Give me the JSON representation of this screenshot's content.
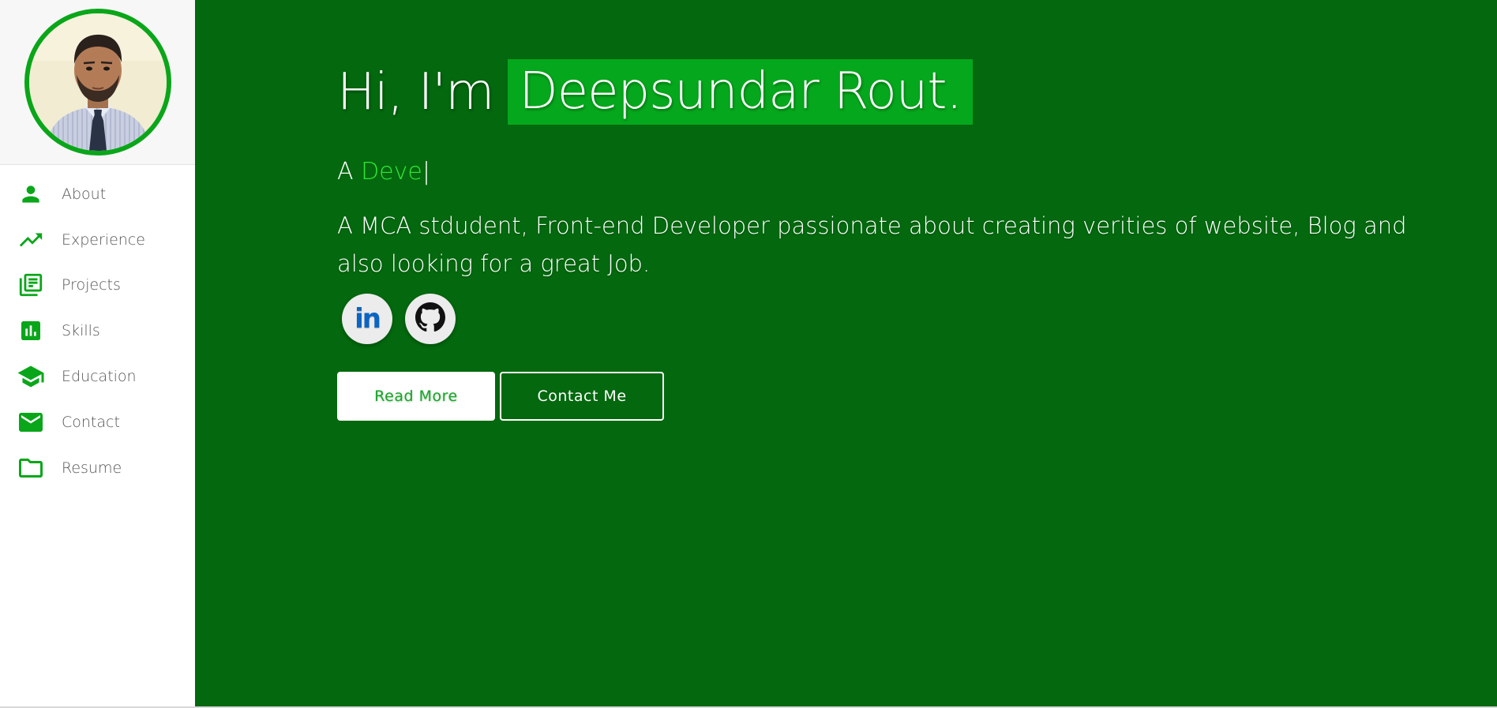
{
  "sidebar": {
    "items": [
      {
        "label": "About",
        "icon": "person-icon"
      },
      {
        "label": "Experience",
        "icon": "trending-up-icon"
      },
      {
        "label": "Projects",
        "icon": "library-books-icon"
      },
      {
        "label": "Skills",
        "icon": "bar-chart-icon"
      },
      {
        "label": "Education",
        "icon": "school-icon"
      },
      {
        "label": "Contact",
        "icon": "email-icon"
      },
      {
        "label": "Resume",
        "icon": "folder-icon"
      }
    ],
    "accent_color": "#0aa61a"
  },
  "hero": {
    "greeting_prefix": "Hi, I'm",
    "name": "Deepsundar Rout.",
    "role_prefix": "A",
    "role_typed": "Deve",
    "cursor": "|",
    "bio": "A MCA stdudent, Front-end Developer passionate about creating verities of website, Blog and also looking for a great Job.",
    "background_color": "#03680e",
    "highlight_color": "#05a81c"
  },
  "socials": [
    {
      "name": "linkedin-icon",
      "glyph": "in"
    },
    {
      "name": "github-icon"
    }
  ],
  "actions": {
    "read_more": "Read More",
    "contact_me": "Contact Me"
  }
}
